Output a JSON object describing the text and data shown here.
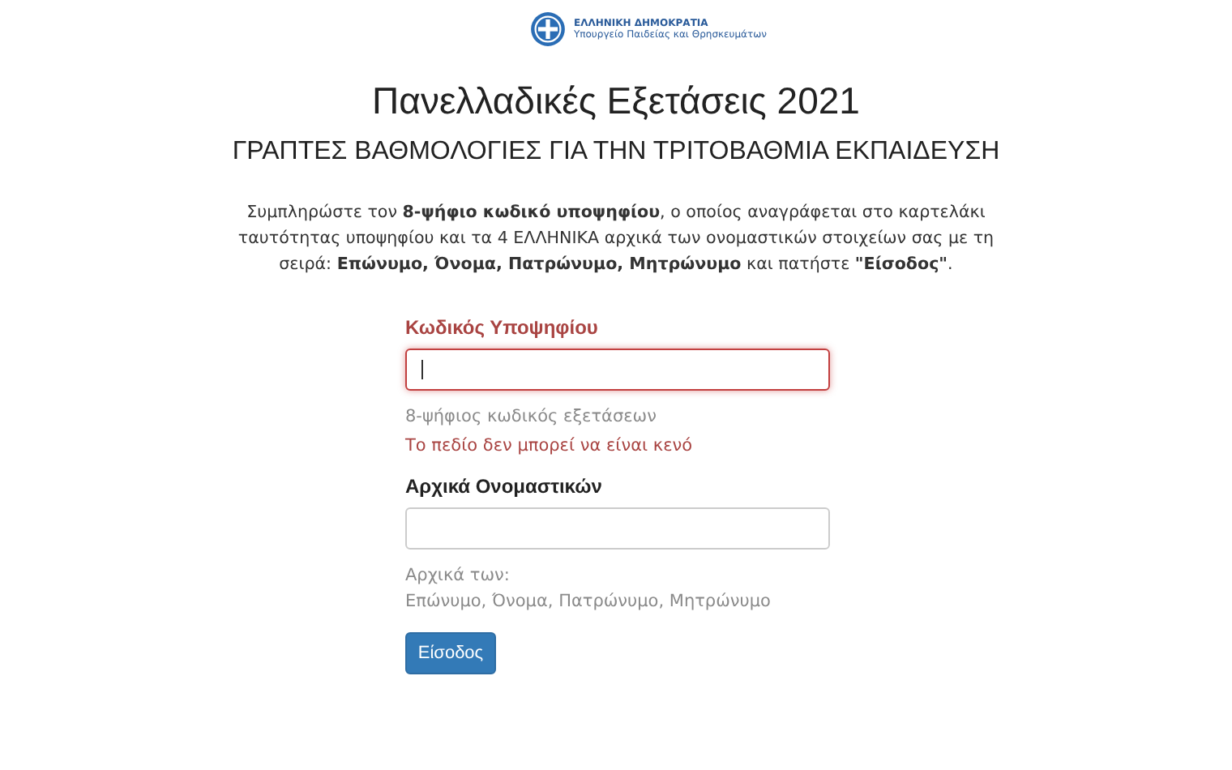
{
  "header": {
    "line1": "ΕΛΛΗΝΙΚΗ ΔΗΜΟΚΡΑΤΙΑ",
    "line2": "Υπουργείο Παιδείας και Θρησκευμάτων"
  },
  "title": "Πανελλαδικές Εξετάσεις 2021",
  "subtitle": "ΓΡΑΠΤΕΣ ΒΑΘΜΟΛΟΓΙΕΣ ΓΙΑ ΤΗΝ ΤΡΙΤΟΒΑΘΜΙΑ ΕΚΠΑΙΔΕΥΣΗ",
  "instructions": "Συμπληρώστε τον **8-ψήφιο κωδικό υποψηφίου**, ο οποίος αναγράφεται στο καρτελάκι ταυτότητας υποψηφίου και τα 4 ΕΛΛΗΝΙΚΑ αρχικά των ονομαστικών στοιχείων σας με τη σειρά: **Επώνυμο, Όνομα, Πατρώνυμο, Μητρώνυμο** και πατήστε **\"Είσοδος\"**.",
  "fields": [
    {
      "label": "Κωδικός Υποψηφίου",
      "error": true,
      "focused": true,
      "help": [
        "8-ψήφιος κωδικός εξετάσεων"
      ],
      "error_message": "Το πεδίο δεν μπορεί να είναι κενό"
    },
    {
      "label": "Αρχικά Ονομαστικών",
      "error": false,
      "focused": false,
      "help": [
        "Αρχικά των:",
        "Επώνυμο, Όνομα, Πατρώνυμο, Μητρώνυμο"
      ]
    }
  ],
  "submit": "Είσοδος"
}
